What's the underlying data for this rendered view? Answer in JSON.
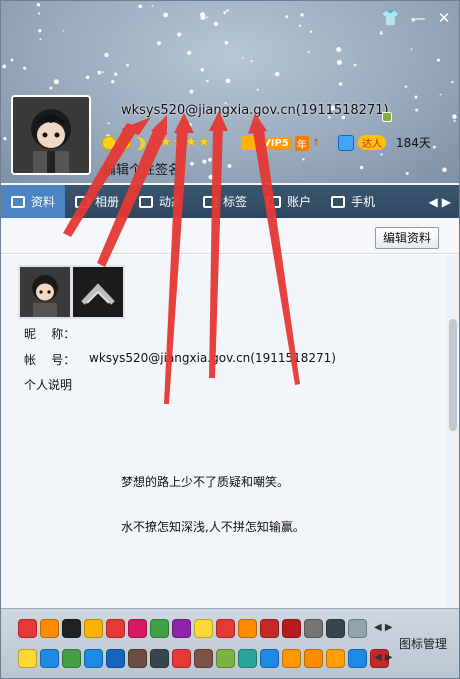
{
  "window": {
    "controls": [
      "shirt-icon",
      "minimize-icon",
      "close-icon"
    ]
  },
  "profile": {
    "account_display": "wksys520@jiangxia.gov.cn(1911518271)",
    "signature": "编辑个性签名",
    "vip_label": "VIP5",
    "vip_year": "年",
    "talent_label": "达人",
    "days": "184天"
  },
  "tabs": [
    {
      "label": "资料",
      "icon": "profile-card-icon"
    },
    {
      "label": "相册",
      "icon": "photo-album-icon"
    },
    {
      "label": "动态",
      "icon": "feed-list-icon"
    },
    {
      "label": "标签",
      "icon": "tag-icon"
    },
    {
      "label": "账户",
      "icon": "wallet-icon"
    },
    {
      "label": "手机",
      "icon": "phone-icon"
    }
  ],
  "toolbar": {
    "edit_label": "编辑资料"
  },
  "info": {
    "nickname_label": "昵    称：",
    "nickname_value": "",
    "account_label": "帐    号：",
    "account_value": "wksys520@jiangxia.gov.cn(1911518271)",
    "bio_label": "个人说明"
  },
  "bio": {
    "line1": "梦想的路上少不了质疑和嘲笑。",
    "line2": "水不撩怎知深浅,人不拼怎知输赢。"
  },
  "bottom": {
    "icon_manager": "图标管理",
    "colors": {
      "row1": [
        "#e53935",
        "#fb8c00",
        "#212121",
        "#ffb300",
        "#e53935",
        "#d81b60",
        "#43a047",
        "#8e24aa",
        "#fdd835",
        "#e53935",
        "#fb8c00",
        "#c62828",
        "#b71c1c",
        "#757575",
        "#37474f",
        "#90a4ae"
      ],
      "row2": [
        "#fdd835",
        "#1e88e5",
        "#43a047",
        "#1e88e5",
        "#1565c0",
        "#6d4c41",
        "#37474f",
        "#e53935",
        "#795548",
        "#7cb342",
        "#26a69a",
        "#1e88e5",
        "#ff9800",
        "#fb8c00",
        "#ffa000",
        "#1e88e5",
        "#c62828"
      ]
    }
  },
  "colors": {
    "tab_bar": "#2f4860",
    "tab_active": "#4c84c4",
    "annotation_arrow": "#e53935"
  }
}
